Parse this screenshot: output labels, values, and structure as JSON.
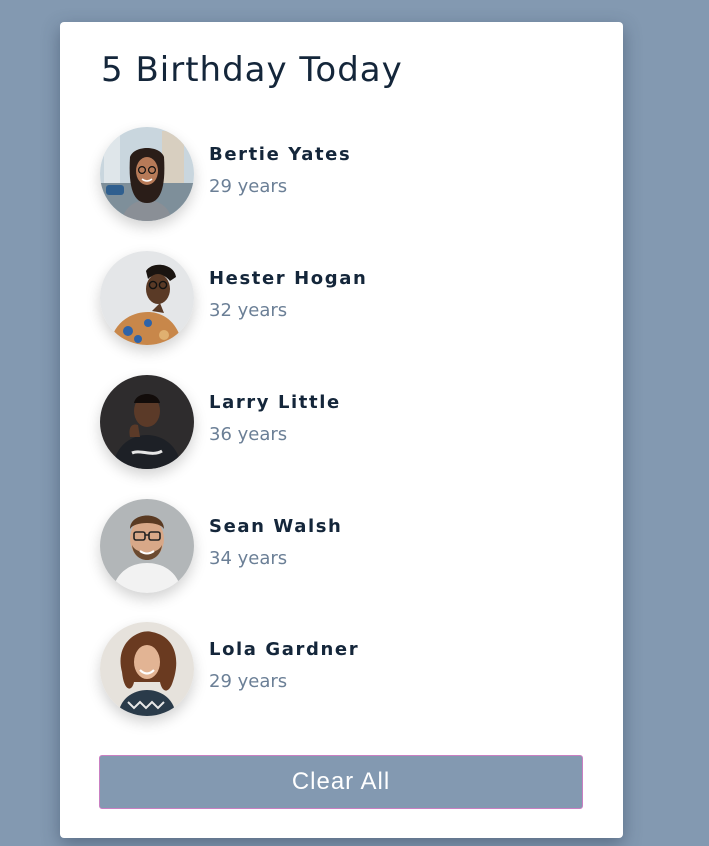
{
  "header": {
    "title": "5 Birthday Today"
  },
  "people": [
    {
      "name": "Bertie Yates",
      "age": "29 years",
      "avatar_icon": "woman-glasses-city-photo"
    },
    {
      "name": "Hester Hogan",
      "age": "32 years",
      "avatar_icon": "woman-glasses-floral-top-photo"
    },
    {
      "name": "Larry Little",
      "age": "36 years",
      "avatar_icon": "man-dark-shirt-photo"
    },
    {
      "name": "Sean Walsh",
      "age": "34 years",
      "avatar_icon": "man-glasses-beard-photo"
    },
    {
      "name": "Lola Gardner",
      "age": "29 years",
      "avatar_icon": "woman-curly-hair-photo"
    }
  ],
  "actions": {
    "clear_label": "Clear All"
  },
  "colors": {
    "background": "#8399b1",
    "card": "#ffffff",
    "title_text": "#14263a",
    "secondary_text": "#6b7f96",
    "button_bg": "#8399b1",
    "button_border": "#c97fc2"
  }
}
